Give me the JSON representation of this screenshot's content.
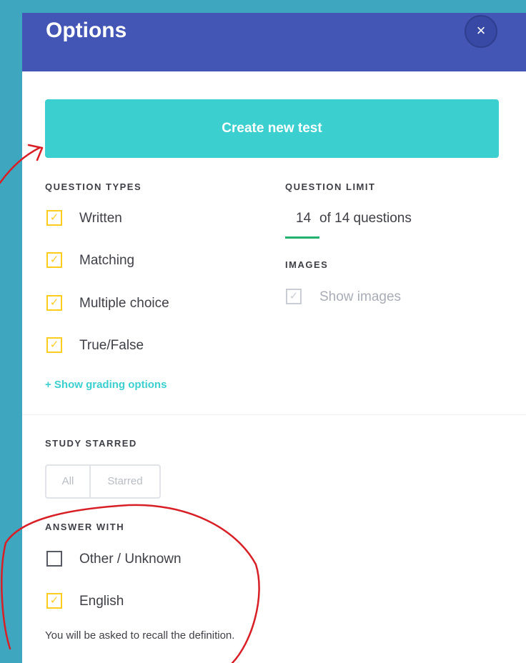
{
  "modal": {
    "title": "Options",
    "close_label": "×"
  },
  "create_button": "Create new test",
  "question_types": {
    "label": "QUESTION TYPES",
    "options": [
      {
        "label": "Written",
        "checked": true
      },
      {
        "label": "Matching",
        "checked": true
      },
      {
        "label": "Multiple choice",
        "checked": true
      },
      {
        "label": "True/False",
        "checked": true
      }
    ]
  },
  "question_limit": {
    "label": "QUESTION LIMIT",
    "value": "14",
    "suffix": "of 14 questions"
  },
  "images": {
    "label": "IMAGES",
    "show_images": "Show images",
    "checked": true,
    "disabled": true
  },
  "grading_link": "+ Show grading options",
  "study_starred": {
    "label": "STUDY STARRED",
    "options": [
      "All",
      "Starred"
    ]
  },
  "answer_with": {
    "label": "ANSWER WITH",
    "options": [
      {
        "label": "Other / Unknown",
        "checked": false
      },
      {
        "label": "English",
        "checked": true
      }
    ],
    "hint": "You will be asked to recall the definition."
  },
  "check_glyph": "✓",
  "colors": {
    "page_bg": "#3ea6bf",
    "header": "#4355b5",
    "accent": "#3ccfcf",
    "checkbox": "#ffcd1f",
    "underline": "#23b26d",
    "annotation": "#d81f26"
  }
}
